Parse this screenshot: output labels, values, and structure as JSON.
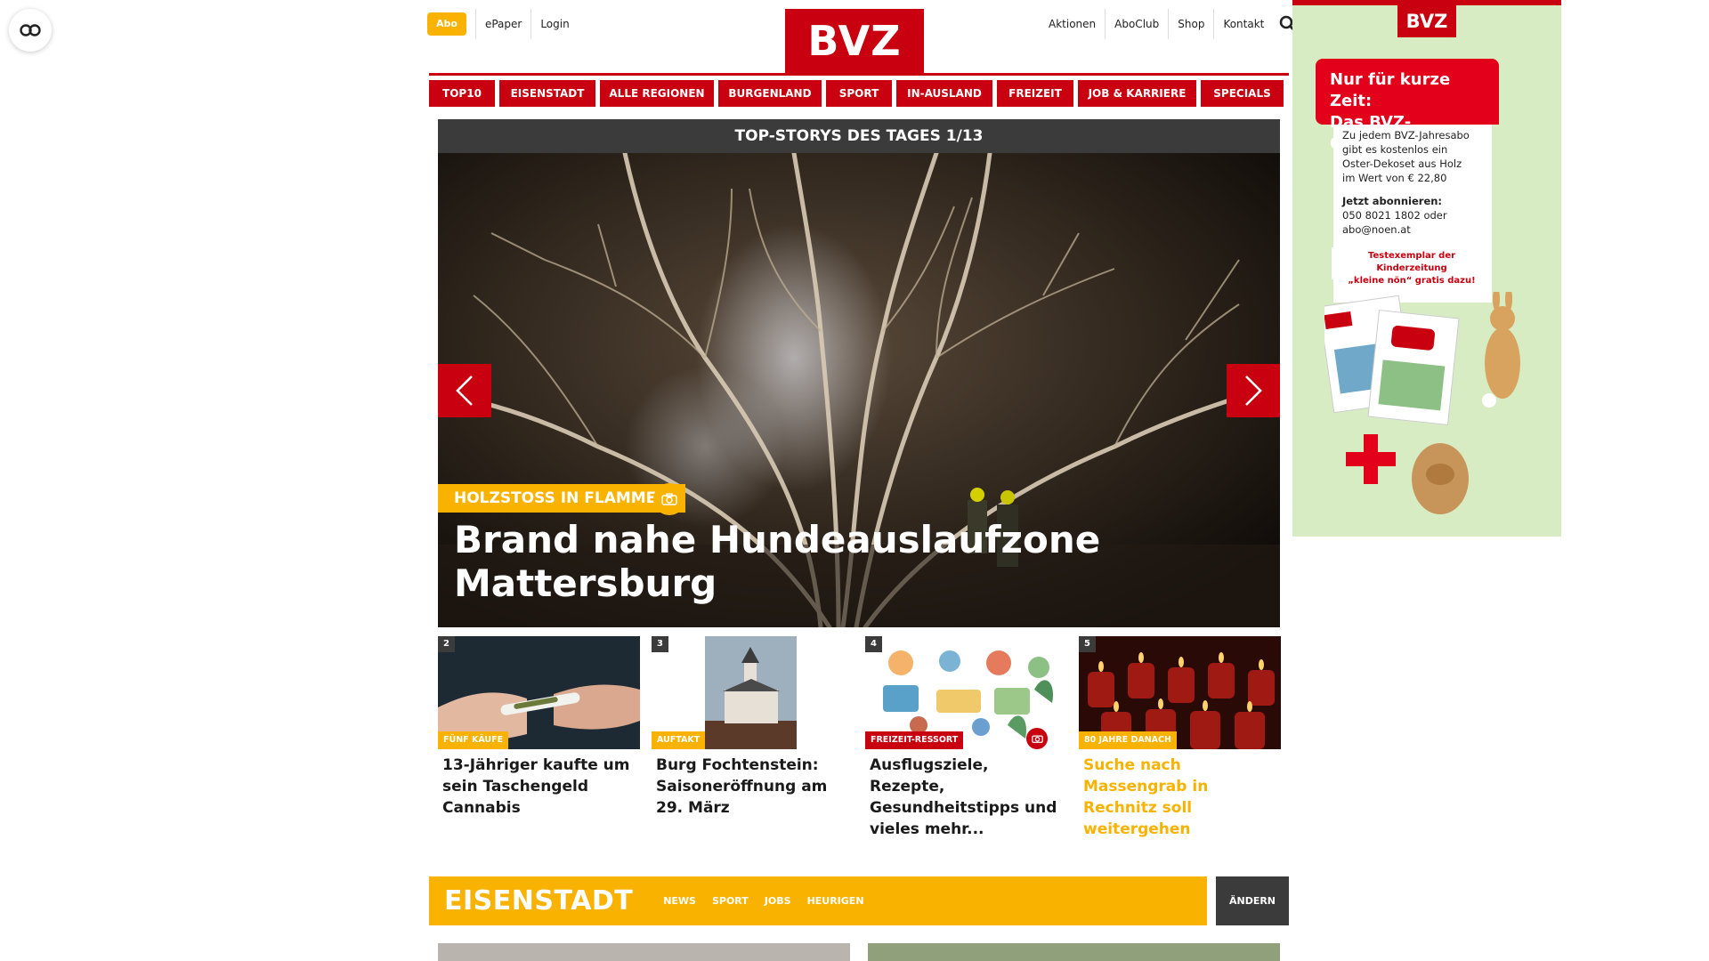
{
  "header": {
    "abo_label": "Abo",
    "epaper_label": "ePaper",
    "login_label": "Login",
    "logo_text": "BVZ",
    "right_links": [
      "Aktionen",
      "AboClub",
      "Shop",
      "Kontakt"
    ]
  },
  "nav": {
    "items": [
      "TOP10",
      "EISENSTADT",
      "ALLE REGIONEN",
      "BURGENLAND",
      "SPORT",
      "IN-AUSLAND",
      "FREIZEIT",
      "JOB & KARRIERE",
      "SPECIALS"
    ]
  },
  "hero": {
    "bar_title": "TOP-STORYS DES TAGES 1/13",
    "tag": "HOLZSTOSS IN FLAMMEN",
    "title": "Brand nahe Hundeauslaufzone Mattersburg"
  },
  "cards": [
    {
      "num": "2",
      "tag": "FÜNF KÄUFE",
      "title": "13-Jähriger kaufte um sein Taschengeld Cannabis"
    },
    {
      "num": "3",
      "tag": "AUFTAKT",
      "title": "Burg Fochtenstein: Saisoneröffnung am 29. März"
    },
    {
      "num": "4",
      "tag": "FREIZEIT-RESSORT",
      "title": "Ausflugsziele, Rezepte, Gesundheitstipps und vieles mehr..."
    },
    {
      "num": "5",
      "tag": "80 JAHRE DANACH",
      "title": "Suche nach Massengrab in Rechnitz soll weitergehen"
    }
  ],
  "region": {
    "title": "EISENSTADT",
    "links": [
      "NEWS",
      "SPORT",
      "JOBS",
      "HEURIGEN"
    ],
    "change_label": "ÄNDERN"
  },
  "ad": {
    "logo": "BVZ",
    "headline_1": "Nur für kurze Zeit:",
    "headline_2": "Das BVZ-Osterabo!",
    "body_1": "Zu jedem BVZ-Jahresabo",
    "body_2": "gibt es kostenlos ein",
    "body_3": "Oster-Dekoset aus Holz",
    "body_4": "im Wert von € 22,80",
    "cta": "Jetzt abonnieren:",
    "phone": "050 8021 1802 oder",
    "email": "abo@noen.at",
    "note_1": "Testexemplar der Kinderzeitung",
    "note_2": "„kleine nön“ gratis dazu!"
  },
  "colors": {
    "brand_red": "#c8000f",
    "accent_yellow": "#f9b200",
    "dark_bar": "#3b3b3b"
  },
  "icons": [
    "accessibility-icon",
    "search-icon",
    "chevron-left-icon",
    "chevron-right-icon",
    "camera-icon"
  ]
}
